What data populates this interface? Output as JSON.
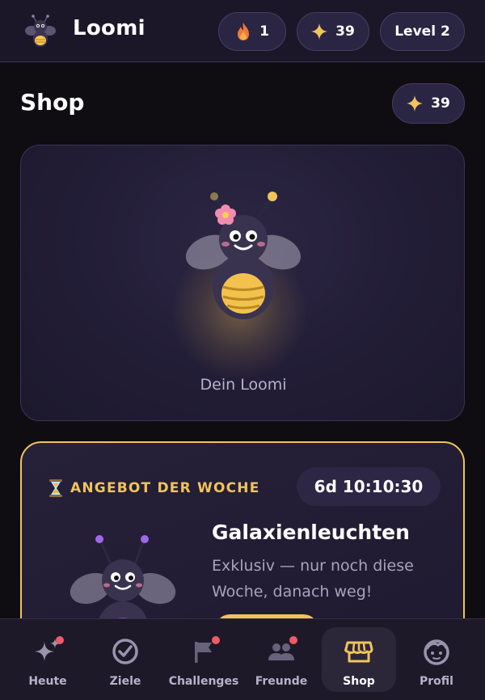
{
  "header": {
    "app_title": "Loomi",
    "streak": "1",
    "stars": "39",
    "level": "Level 2"
  },
  "shop": {
    "title": "Shop",
    "stars": "39",
    "mascot_caption": "Dein Loomi"
  },
  "offer": {
    "tag": "ANGEBOT DER WOCHE",
    "countdown": "6d 10:10:30",
    "name": "Galaxienleuchten",
    "description": "Exklusiv — nur noch diese Woche, danach weg!"
  },
  "nav": {
    "items": [
      {
        "label": "Heute",
        "icon": "sparkles-icon",
        "badge": true
      },
      {
        "label": "Ziele",
        "icon": "check-circle-icon",
        "badge": false
      },
      {
        "label": "Challenges",
        "icon": "flag-icon",
        "badge": true
      },
      {
        "label": "Freunde",
        "icon": "people-icon",
        "badge": true
      },
      {
        "label": "Shop",
        "icon": "shop-icon",
        "badge": false,
        "active": true
      },
      {
        "label": "Profil",
        "icon": "face-icon",
        "badge": false
      }
    ]
  },
  "colors": {
    "accent_gold": "#f1c35c",
    "background": "#0f0d12",
    "surface": "#1b1729",
    "badge_red": "#ef5a68"
  }
}
